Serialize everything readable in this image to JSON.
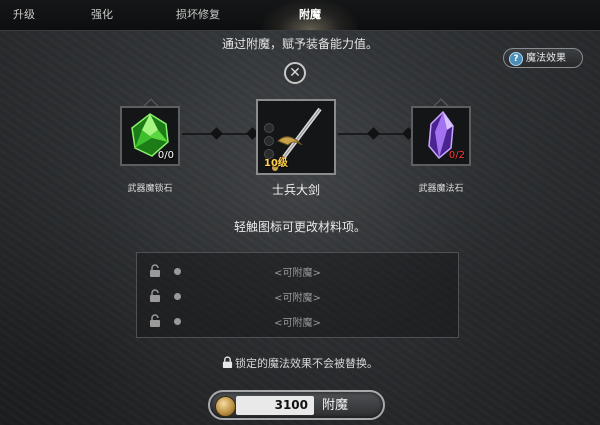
{
  "tabs": [
    {
      "label": "升级",
      "active": false
    },
    {
      "label": "强化",
      "active": false
    },
    {
      "label": "损坏修复",
      "active": false
    },
    {
      "label": "附魔",
      "active": true
    }
  ],
  "instruction": "通过附魔，赋予装备能力值。",
  "magic_effect_button": {
    "label": "魔法效果",
    "icon": "question-icon"
  },
  "close_icon": "close-icon",
  "left_slot": {
    "count": "0/0",
    "label": "武器魔锁石",
    "gem_color": "#3fbf2e"
  },
  "center_slot": {
    "level": "10级",
    "label": "士兵大剑"
  },
  "right_slot": {
    "count": "0/2",
    "label": "武器魔法石",
    "gem_color": "#8a4fd8"
  },
  "hint": "轻触图标可更改材料项。",
  "options": [
    {
      "text": "<可附魔>"
    },
    {
      "text": "<可附魔>"
    },
    {
      "text": "<可附魔>"
    }
  ],
  "lock_note": "锁定的魔法效果不会被替换。",
  "enchant_button": {
    "cost": "3100",
    "label": "附魔"
  },
  "colors": {
    "accent_gold": "#ffd34a",
    "count_red": "#ff3b3b"
  }
}
